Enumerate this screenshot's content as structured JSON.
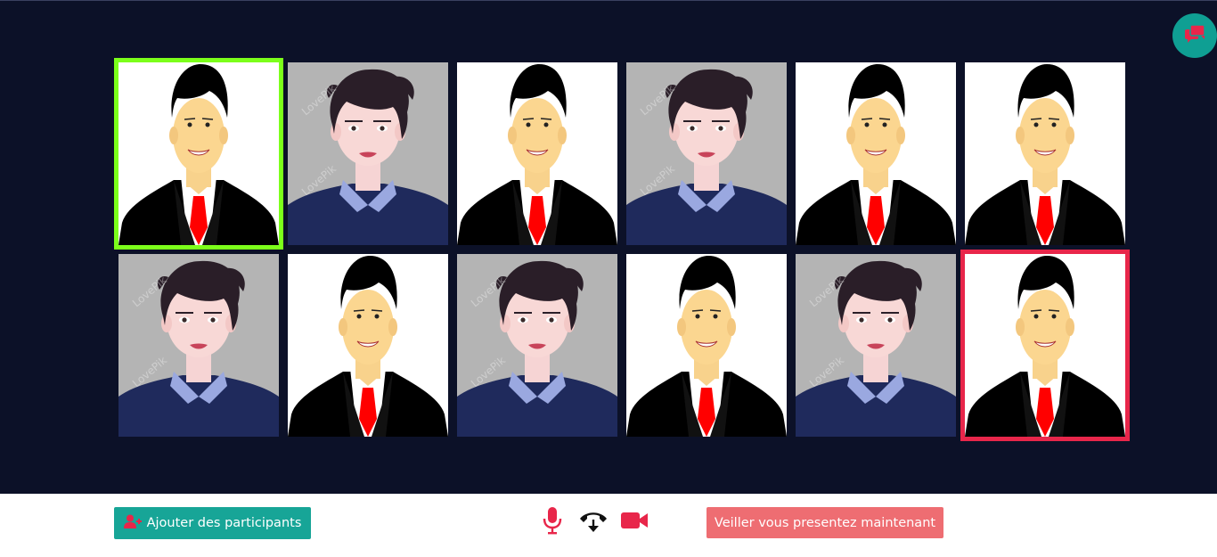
{
  "toolbar": {
    "add_participants_label": "Ajouter des participants",
    "present_now_label": "Veiller vous presentez maintenant"
  },
  "icons": {
    "chat": "chat-bubbles-icon",
    "add_user": "user-plus-icon",
    "mic": "microphone-icon",
    "hangup": "phone-hangup-icon",
    "camera": "video-camera-icon"
  },
  "colors": {
    "stage_bg": "#0c1128",
    "accent_teal": "#17a597",
    "accent_red": "#e8264a",
    "speaking_border": "#7cff1a",
    "present_button": "#ee6d72"
  },
  "participants": [
    {
      "avatar": "businessman",
      "state": "speaking"
    },
    {
      "avatar": "woman",
      "state": "normal"
    },
    {
      "avatar": "businessman",
      "state": "normal"
    },
    {
      "avatar": "woman",
      "state": "normal"
    },
    {
      "avatar": "businessman",
      "state": "normal"
    },
    {
      "avatar": "businessman",
      "state": "normal"
    },
    {
      "avatar": "woman",
      "state": "normal"
    },
    {
      "avatar": "businessman",
      "state": "normal"
    },
    {
      "avatar": "woman",
      "state": "normal"
    },
    {
      "avatar": "businessman",
      "state": "normal"
    },
    {
      "avatar": "woman",
      "state": "normal"
    },
    {
      "avatar": "businessman",
      "state": "selected"
    }
  ]
}
